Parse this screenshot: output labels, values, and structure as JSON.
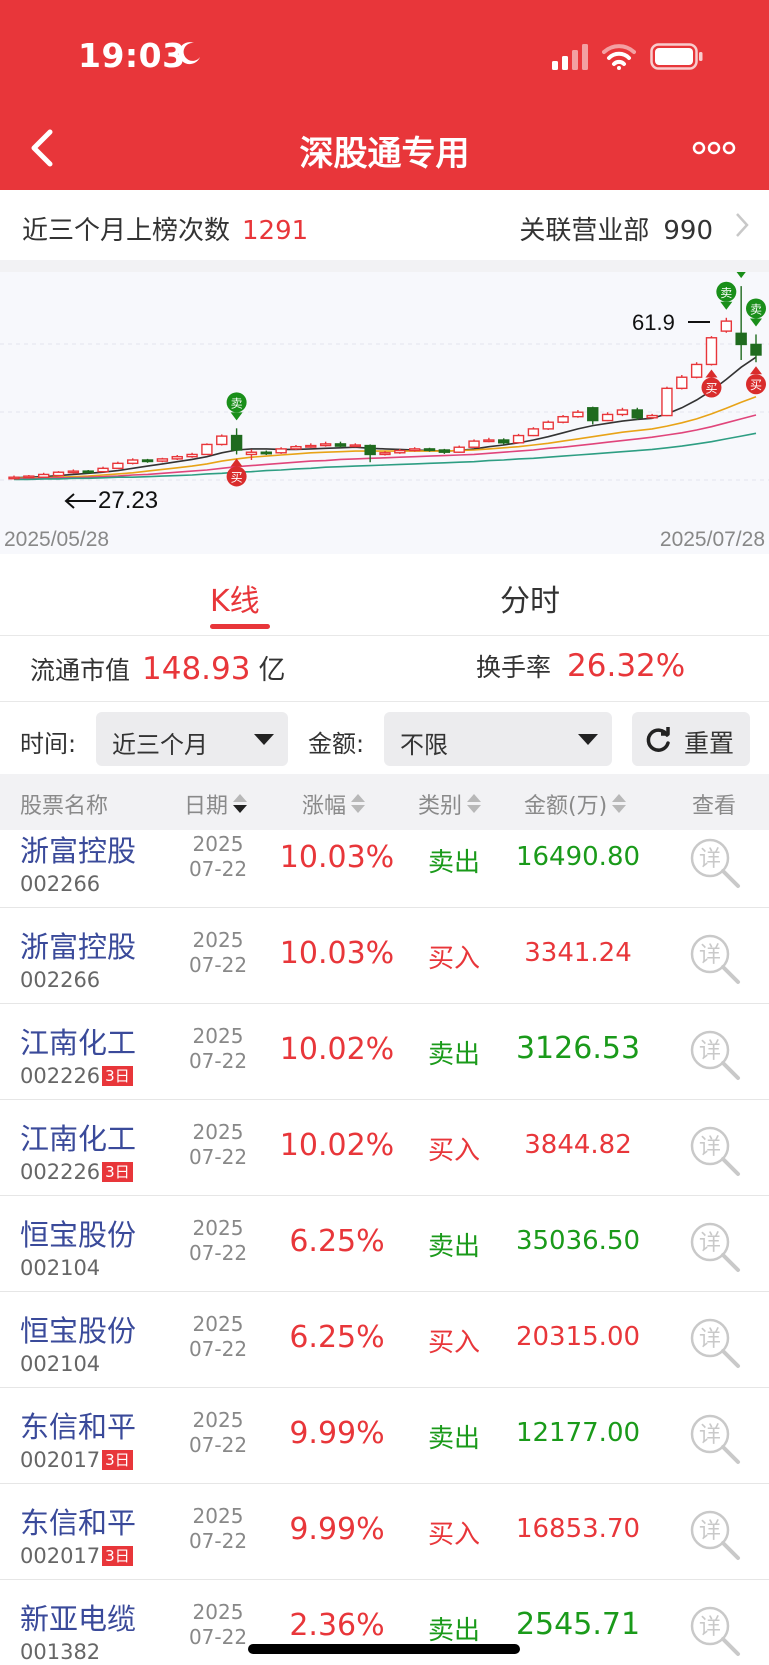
{
  "status": {
    "time": "19:03"
  },
  "nav": {
    "title": "深股通专用"
  },
  "summary": {
    "count_label": "近三个月上榜次数",
    "count_value": "1291",
    "branch_label": "关联营业部",
    "branch_value": "990"
  },
  "chart_data": {
    "type": "candlestick",
    "start_date": "2025/05/28",
    "end_date": "2025/07/28",
    "high_label": "61.9",
    "low_label": "27.23",
    "buy_label": "买",
    "sell_label": "卖",
    "candles": [
      {
        "o": 27.3,
        "c": 27.5,
        "h": 27.8,
        "l": 27.23
      },
      {
        "o": 27.6,
        "c": 27.7,
        "h": 27.9,
        "l": 27.4
      },
      {
        "o": 27.5,
        "c": 28.0,
        "h": 28.3,
        "l": 27.4
      },
      {
        "o": 27.8,
        "c": 28.4,
        "h": 28.6,
        "l": 27.7
      },
      {
        "o": 28.4,
        "c": 28.6,
        "h": 28.9,
        "l": 28.2
      },
      {
        "o": 28.6,
        "c": 28.5,
        "h": 28.8,
        "l": 28.3
      },
      {
        "o": 28.5,
        "c": 29.1,
        "h": 29.4,
        "l": 28.4
      },
      {
        "o": 29.1,
        "c": 30.0,
        "h": 30.3,
        "l": 29.0
      },
      {
        "o": 30.0,
        "c": 30.6,
        "h": 30.9,
        "l": 29.8
      },
      {
        "o": 30.6,
        "c": 30.4,
        "h": 30.8,
        "l": 30.1
      },
      {
        "o": 30.4,
        "c": 30.8,
        "h": 31.0,
        "l": 30.2
      },
      {
        "o": 30.8,
        "c": 31.2,
        "h": 31.5,
        "l": 30.6
      },
      {
        "o": 31.2,
        "c": 31.6,
        "h": 31.9,
        "l": 31.0
      },
      {
        "o": 31.6,
        "c": 33.4,
        "h": 33.6,
        "l": 31.5
      },
      {
        "o": 33.4,
        "c": 34.9,
        "h": 35.2,
        "l": 33.2
      },
      {
        "o": 35.0,
        "c": 32.4,
        "h": 36.3,
        "l": 31.6
      },
      {
        "o": 31.6,
        "c": 32.0,
        "h": 32.5,
        "l": 30.6
      },
      {
        "o": 32.0,
        "c": 31.9,
        "h": 32.3,
        "l": 31.5
      },
      {
        "o": 31.9,
        "c": 32.6,
        "h": 32.9,
        "l": 31.7
      },
      {
        "o": 32.6,
        "c": 33.0,
        "h": 33.3,
        "l": 32.4
      },
      {
        "o": 33.0,
        "c": 33.2,
        "h": 33.6,
        "l": 32.8
      },
      {
        "o": 33.2,
        "c": 33.5,
        "h": 33.9,
        "l": 33.0
      },
      {
        "o": 33.5,
        "c": 33.1,
        "h": 33.9,
        "l": 32.8
      },
      {
        "o": 33.1,
        "c": 33.3,
        "h": 33.6,
        "l": 32.9
      },
      {
        "o": 33.2,
        "c": 31.6,
        "h": 33.4,
        "l": 30.2
      },
      {
        "o": 31.6,
        "c": 31.9,
        "h": 32.2,
        "l": 31.4
      },
      {
        "o": 31.9,
        "c": 32.3,
        "h": 32.6,
        "l": 31.7
      },
      {
        "o": 32.3,
        "c": 32.6,
        "h": 32.9,
        "l": 32.1
      },
      {
        "o": 32.6,
        "c": 32.4,
        "h": 32.8,
        "l": 32.1
      },
      {
        "o": 32.4,
        "c": 32.0,
        "h": 32.6,
        "l": 31.7
      },
      {
        "o": 32.0,
        "c": 32.9,
        "h": 33.2,
        "l": 31.9
      },
      {
        "o": 32.9,
        "c": 34.0,
        "h": 34.3,
        "l": 32.8
      },
      {
        "o": 34.0,
        "c": 34.2,
        "h": 34.6,
        "l": 33.8
      },
      {
        "o": 34.2,
        "c": 33.7,
        "h": 34.5,
        "l": 33.4
      },
      {
        "o": 33.7,
        "c": 35.0,
        "h": 35.3,
        "l": 33.6
      },
      {
        "o": 35.0,
        "c": 36.2,
        "h": 36.5,
        "l": 34.9
      },
      {
        "o": 36.2,
        "c": 37.4,
        "h": 37.7,
        "l": 36.0
      },
      {
        "o": 37.4,
        "c": 38.4,
        "h": 38.7,
        "l": 37.2
      },
      {
        "o": 38.4,
        "c": 39.2,
        "h": 39.6,
        "l": 38.2
      },
      {
        "o": 40.0,
        "c": 37.7,
        "h": 40.2,
        "l": 37.0
      },
      {
        "o": 37.7,
        "c": 38.8,
        "h": 39.2,
        "l": 37.6
      },
      {
        "o": 38.8,
        "c": 39.6,
        "h": 40.0,
        "l": 38.5
      },
      {
        "o": 39.6,
        "c": 38.2,
        "h": 40.0,
        "l": 37.8
      },
      {
        "o": 38.2,
        "c": 38.6,
        "h": 38.9,
        "l": 38.0
      },
      {
        "o": 38.6,
        "c": 43.5,
        "h": 43.8,
        "l": 38.5
      },
      {
        "o": 43.5,
        "c": 45.5,
        "h": 45.9,
        "l": 43.3
      },
      {
        "o": 45.5,
        "c": 47.8,
        "h": 48.2,
        "l": 45.3
      },
      {
        "o": 47.8,
        "c": 52.6,
        "h": 52.9,
        "l": 47.6
      },
      {
        "o": 53.8,
        "c": 55.6,
        "h": 56.2,
        "l": 53.5
      },
      {
        "o": 53.4,
        "c": 51.4,
        "h": 61.9,
        "l": 48.6
      },
      {
        "o": 51.4,
        "c": 49.5,
        "h": 53.2,
        "l": 48.2
      }
    ],
    "ma_lines": [
      {
        "name": "ma_short",
        "color": "#333333",
        "values": [
          27.4,
          27.5,
          27.6,
          27.8,
          28.0,
          28.2,
          28.4,
          28.7,
          29.1,
          29.5,
          29.9,
          30.3,
          30.7,
          31.2,
          31.9,
          32.4,
          32.6,
          32.6,
          32.5,
          32.5,
          32.6,
          32.7,
          32.8,
          32.9,
          32.7,
          32.6,
          32.5,
          32.4,
          32.3,
          32.2,
          32.3,
          32.6,
          33.0,
          33.3,
          33.7,
          34.2,
          34.8,
          35.5,
          36.2,
          36.8,
          37.2,
          37.6,
          37.9,
          38.1,
          38.9,
          40.0,
          41.4,
          43.1,
          45.1,
          47.3,
          49.1
        ]
      },
      {
        "name": "ma_mid",
        "color": "#e8a317",
        "values": [
          27.3,
          27.4,
          27.4,
          27.5,
          27.6,
          27.7,
          27.9,
          28.1,
          28.3,
          28.6,
          28.9,
          29.2,
          29.5,
          29.9,
          30.4,
          30.8,
          31.1,
          31.3,
          31.5,
          31.7,
          31.9,
          32.0,
          32.1,
          32.2,
          32.2,
          32.2,
          32.2,
          32.2,
          32.2,
          32.2,
          32.3,
          32.4,
          32.6,
          32.8,
          33.0,
          33.3,
          33.6,
          34.0,
          34.4,
          34.8,
          35.2,
          35.6,
          35.9,
          36.2,
          36.7,
          37.3,
          38.0,
          38.9,
          39.9,
          41.0,
          42.0
        ]
      },
      {
        "name": "ma_long",
        "color": "#e0457b",
        "values": [
          27.2,
          27.3,
          27.3,
          27.4,
          27.4,
          27.5,
          27.6,
          27.7,
          27.9,
          28.0,
          28.2,
          28.4,
          28.6,
          28.8,
          29.1,
          29.4,
          29.6,
          29.8,
          30.0,
          30.2,
          30.4,
          30.5,
          30.7,
          30.8,
          30.9,
          31.0,
          31.1,
          31.2,
          31.3,
          31.4,
          31.5,
          31.6,
          31.8,
          32.0,
          32.2,
          32.4,
          32.7,
          32.9,
          33.2,
          33.5,
          33.8,
          34.1,
          34.4,
          34.7,
          35.1,
          35.5,
          36.0,
          36.6,
          37.3,
          38.0,
          38.7
        ]
      },
      {
        "name": "ma_longest",
        "color": "#2e9e83",
        "values": [
          27.1,
          27.1,
          27.2,
          27.2,
          27.3,
          27.3,
          27.4,
          27.5,
          27.5,
          27.6,
          27.7,
          27.8,
          27.9,
          28.1,
          28.2,
          28.4,
          28.5,
          28.7,
          28.8,
          29.0,
          29.1,
          29.3,
          29.4,
          29.5,
          29.6,
          29.7,
          29.8,
          29.9,
          30.0,
          30.1,
          30.2,
          30.3,
          30.5,
          30.6,
          30.8,
          30.9,
          31.1,
          31.3,
          31.5,
          31.7,
          31.9,
          32.1,
          32.3,
          32.5,
          32.8,
          33.1,
          33.5,
          33.9,
          34.4,
          34.9,
          35.4
        ]
      }
    ],
    "markers": [
      {
        "index": 15,
        "type": "sell"
      },
      {
        "index": 15,
        "type": "buy"
      },
      {
        "index": 47,
        "type": "buy"
      },
      {
        "index": 48,
        "type": "sell"
      },
      {
        "index": 49,
        "type": "sell"
      },
      {
        "index": 50,
        "type": "sell"
      },
      {
        "index": 50,
        "type": "buy"
      }
    ]
  },
  "tabs": {
    "kline": "K线",
    "timeshare": "分时"
  },
  "market": {
    "cap_label": "流通市值",
    "cap_value": "148.93",
    "cap_unit": "亿",
    "turnover_label": "换手率",
    "turnover_value": "26.32%"
  },
  "filter": {
    "time_label": "时间:",
    "time_value": "近三个月",
    "amount_label": "金额:",
    "amount_value": "不限",
    "reset_label": "重置"
  },
  "table": {
    "headers": {
      "name": "股票名称",
      "date": "日期",
      "change": "涨幅",
      "type": "类别",
      "amount": "金额(万)",
      "view": "查看"
    },
    "detail_glyph": "详",
    "rows": [
      {
        "name": "浙富控股",
        "code": "002266",
        "badge": "",
        "year": "2025",
        "md": "07-22",
        "change": "10.03%",
        "type": "卖出",
        "amount": "16490.80"
      },
      {
        "name": "浙富控股",
        "code": "002266",
        "badge": "",
        "year": "2025",
        "md": "07-22",
        "change": "10.03%",
        "type": "买入",
        "amount": "3341.24"
      },
      {
        "name": "江南化工",
        "code": "002226",
        "badge": "3日",
        "year": "2025",
        "md": "07-22",
        "change": "10.02%",
        "type": "卖出",
        "amount": "3126.53"
      },
      {
        "name": "江南化工",
        "code": "002226",
        "badge": "3日",
        "year": "2025",
        "md": "07-22",
        "change": "10.02%",
        "type": "买入",
        "amount": "3844.82"
      },
      {
        "name": "恒宝股份",
        "code": "002104",
        "badge": "",
        "year": "2025",
        "md": "07-22",
        "change": "6.25%",
        "type": "卖出",
        "amount": "35036.50"
      },
      {
        "name": "恒宝股份",
        "code": "002104",
        "badge": "",
        "year": "2025",
        "md": "07-22",
        "change": "6.25%",
        "type": "买入",
        "amount": "20315.00"
      },
      {
        "name": "东信和平",
        "code": "002017",
        "badge": "3日",
        "year": "2025",
        "md": "07-22",
        "change": "9.99%",
        "type": "卖出",
        "amount": "12177.00"
      },
      {
        "name": "东信和平",
        "code": "002017",
        "badge": "3日",
        "year": "2025",
        "md": "07-22",
        "change": "9.99%",
        "type": "买入",
        "amount": "16853.70"
      },
      {
        "name": "新亚电缆",
        "code": "001382",
        "badge": "",
        "year": "2025",
        "md": "07-22",
        "change": "2.36%",
        "type": "卖出",
        "amount": "2545.71"
      }
    ]
  },
  "colors": {
    "brand": "#e8363a",
    "buy": "#e8363a",
    "sell": "#1a9a1a",
    "link": "#3a4a9a"
  }
}
